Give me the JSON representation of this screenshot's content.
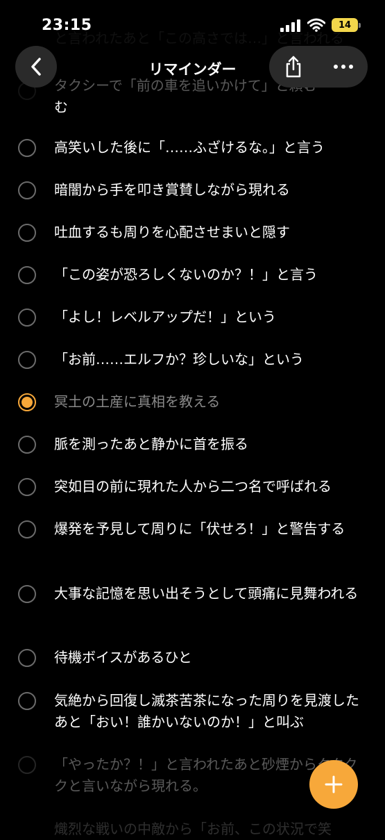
{
  "status_bar": {
    "time": "23:15",
    "battery": "14"
  },
  "header": {
    "title": "リマインダー"
  },
  "ghost_top": "と言われたあと「この高さでは…」と言われる",
  "items": [
    {
      "text": "タクシーで「前の車を追いかけて」と頼む",
      "done": false
    },
    {
      "text": "高笑いした後に「……ふざけるな。」と言う",
      "done": false
    },
    {
      "text": "暗闇から手を叩き賞賛しながら現れる",
      "done": false
    },
    {
      "text": "吐血するも周りを心配させまいと隠す",
      "done": false
    },
    {
      "text": "「この姿が恐ろしくないのか？！」と言う",
      "done": false
    },
    {
      "text": "「よし！レベルアップだ！」という",
      "done": false
    },
    {
      "text": "「お前……エルフか？珍しいな」という",
      "done": false
    },
    {
      "text": "冥土の土産に真相を教える",
      "done": true
    },
    {
      "text": "脈を測ったあと静かに首を振る",
      "done": false
    },
    {
      "text": "突如目の前に現れた人から二つ名で呼ばれる",
      "done": false
    },
    {
      "text": "爆発を予見して周りに「伏せろ！」と警告する",
      "done": false
    },
    {
      "text": "大事な記憶を思い出そうとして頭痛に見舞われる",
      "done": false
    },
    {
      "text": "待機ボイスがあるひと",
      "done": false
    },
    {
      "text": "気絶から回復し滅茶苦茶になった周りを見渡したあと「おい！誰かいないのか！」と叫ぶ",
      "done": false
    },
    {
      "text": "「やったか？！」と言われたあと砂煙からククククと言いながら現れる。",
      "done": false
    },
    {
      "text": "熾烈な戦いの中敵から「お前、この状況で笑",
      "done": false
    }
  ],
  "icons": {
    "back": "chevron-left-icon",
    "share": "share-icon",
    "more": "more-icon",
    "add": "plus-icon"
  },
  "colors": {
    "accent": "#f7a83a",
    "background": "#000000"
  }
}
